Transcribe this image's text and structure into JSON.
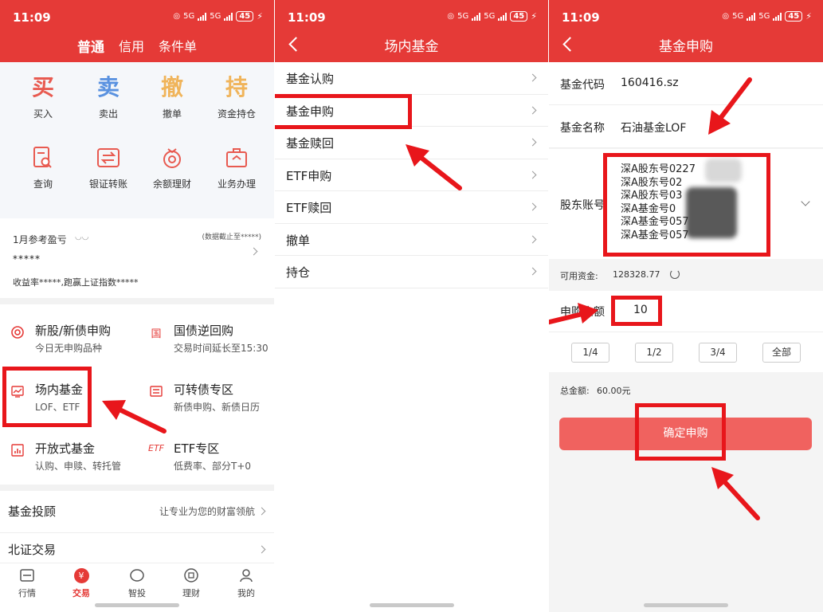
{
  "status": {
    "time": "11:09",
    "battery": "45",
    "net_a": "5G",
    "net_b": "5G"
  },
  "panel1": {
    "tabs": [
      "普通",
      "信用",
      "条件单"
    ],
    "quick_trade": [
      {
        "glyph": "买",
        "label": "买入",
        "color": "#e85a50"
      },
      {
        "glyph": "卖",
        "label": "卖出",
        "color": "#5a92e0"
      },
      {
        "glyph": "撤",
        "label": "撤单",
        "color": "#f0b45a"
      },
      {
        "glyph": "持",
        "label": "资金持仓",
        "color": "#f0b45a"
      }
    ],
    "quick_tools": [
      {
        "label": "查询",
        "icon": "query-icon"
      },
      {
        "label": "银证转账",
        "icon": "transfer-icon"
      },
      {
        "label": "余额理财",
        "icon": "balance-wealth-icon"
      },
      {
        "label": "业务办理",
        "icon": "business-icon"
      }
    ],
    "profit": {
      "title": "1月参考盈亏",
      "date_note": "(数据截止至*****)",
      "value": "*****",
      "sub": "收益率*****,跑赢上证指数*****"
    },
    "features": [
      {
        "title": "新股/新债申购",
        "sub": "今日无申购品种",
        "icon": "ipo-icon"
      },
      {
        "title": "国债逆回购",
        "sub": "交易时间延长至15:30",
        "icon": "treasury-icon",
        "glyph": "国"
      },
      {
        "title": "场内基金",
        "sub": "LOF、ETF",
        "icon": "onsite-fund-icon"
      },
      {
        "title": "可转债专区",
        "sub": "新债申购、新债日历",
        "icon": "convertible-bond-icon"
      },
      {
        "title": "开放式基金",
        "sub": "认购、申赎、转托管",
        "icon": "open-fund-icon"
      },
      {
        "title": "ETF专区",
        "sub": "低费率、部分T+0",
        "icon": "etf-icon",
        "glyph": "ETF"
      }
    ],
    "advisor": {
      "title": "基金投顾",
      "note": "让专业为您的财富领航"
    },
    "bse": {
      "title": "北证交易"
    },
    "bottom_nav": [
      {
        "label": "行情",
        "icon": "market-icon"
      },
      {
        "label": "交易",
        "icon": "trade-icon"
      },
      {
        "label": "智投",
        "icon": "smart-invest-icon"
      },
      {
        "label": "理财",
        "icon": "wealth-icon"
      },
      {
        "label": "我的",
        "icon": "profile-icon"
      }
    ],
    "trade_glyph": "¥"
  },
  "panel2": {
    "title": "场内基金",
    "items": [
      "基金认购",
      "基金申购",
      "基金赎回",
      "ETF申购",
      "ETF赎回",
      "撤单",
      "持仓"
    ]
  },
  "panel3": {
    "title": "基金申购",
    "fund_code_label": "基金代码",
    "fund_code": "160416.sz",
    "fund_name_label": "基金名称",
    "fund_name": "石油基金LOF",
    "account_label": "股东账号",
    "accounts": [
      "深A股东号0227",
      "深A股东号02",
      "深A股东号03",
      "深A基金号0",
      "深A基金号057",
      "深A基金号057"
    ],
    "available_label": "可用资金:",
    "available": "128328.77",
    "amount_label": "申购金额",
    "amount": "10",
    "fractions": [
      "1/4",
      "1/2",
      "3/4",
      "全部"
    ],
    "total_label": "总金额:",
    "total": "60.00元",
    "confirm_label": "确定申购"
  },
  "colors": {
    "brand_red": "#e53a37",
    "confirm_red": "#f0625f",
    "highlight_red": "#e8161b"
  }
}
